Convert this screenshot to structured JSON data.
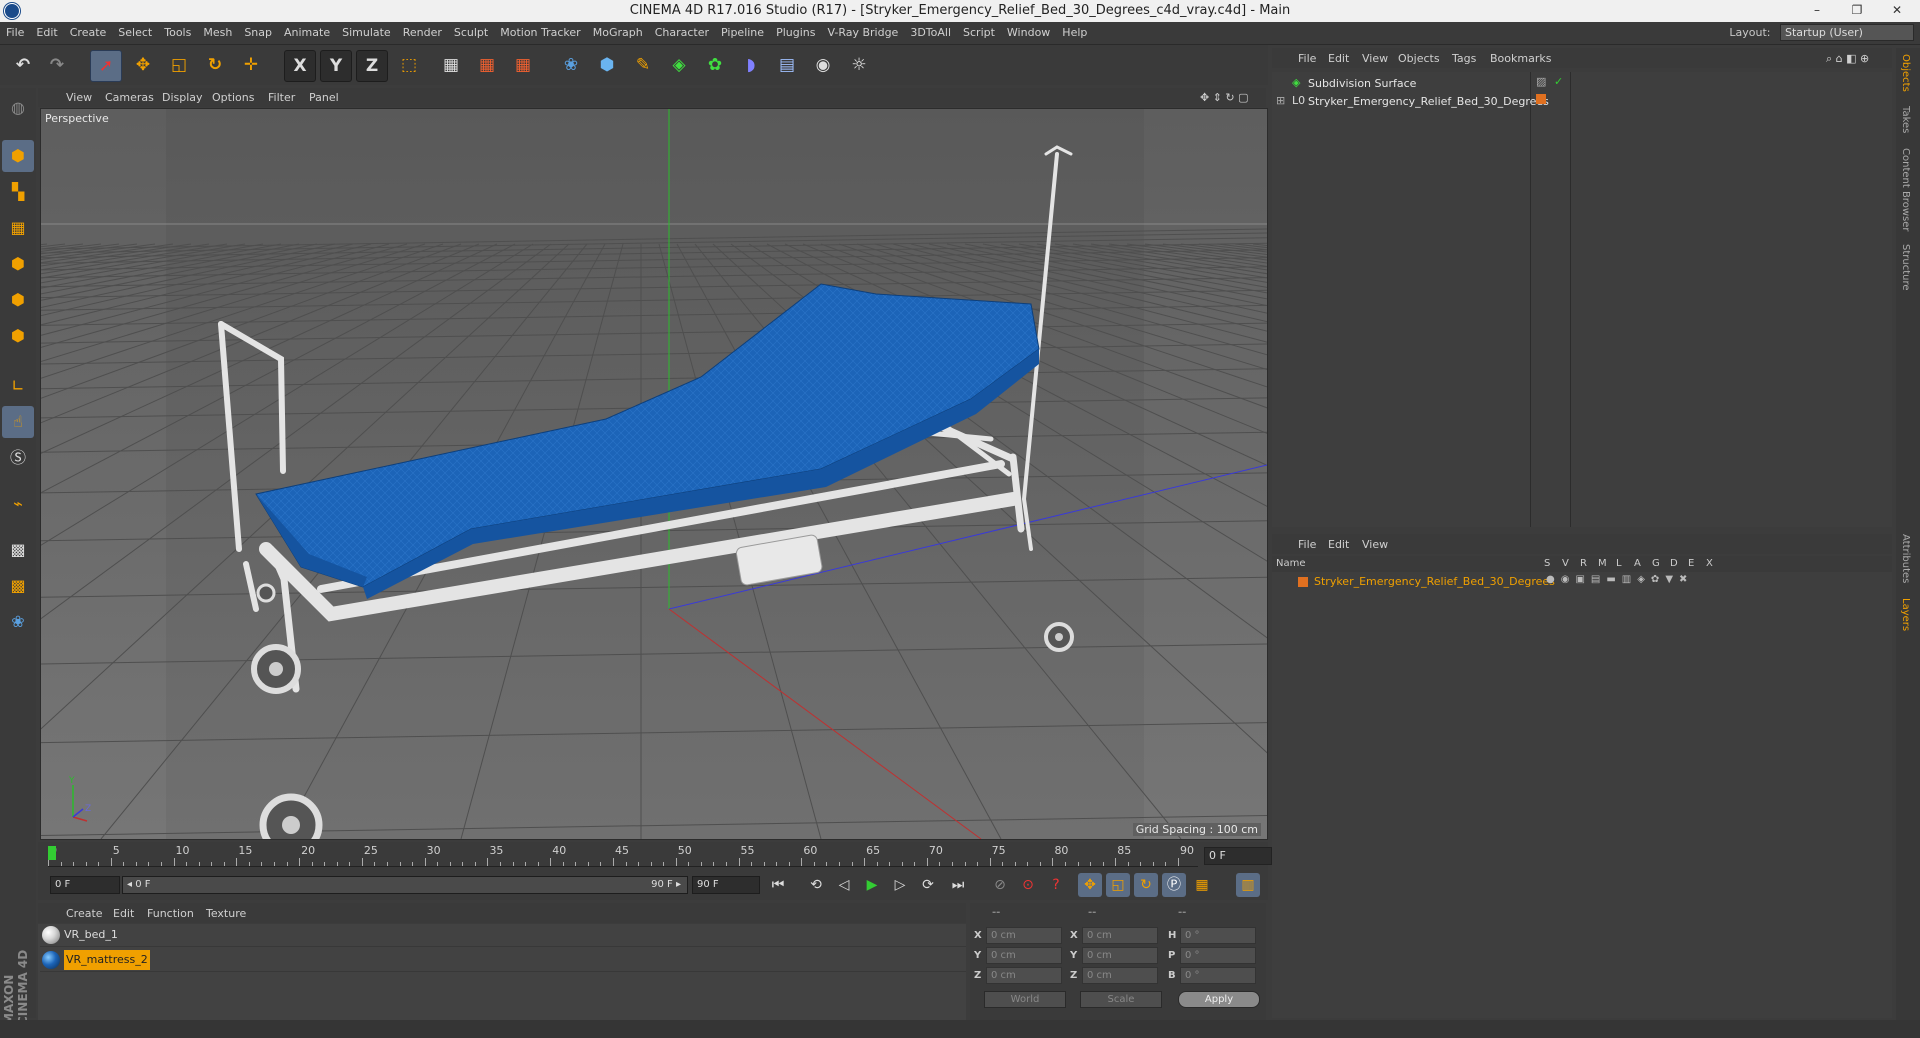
{
  "window": {
    "title": "CINEMA 4D R17.016 Studio (R17) - [Stryker_Emergency_Relief_Bed_30_Degrees_c4d_vray.c4d] - Main",
    "minimize": "–",
    "restore": "❐",
    "close": "✕"
  },
  "menubar": {
    "items": [
      "File",
      "Edit",
      "Create",
      "Select",
      "Tools",
      "Mesh",
      "Snap",
      "Animate",
      "Simulate",
      "Render",
      "Sculpt",
      "Motion Tracker",
      "MoGraph",
      "Character",
      "Pipeline",
      "Plugins",
      "V-Ray Bridge",
      "3DToAll",
      "Script",
      "Window",
      "Help"
    ],
    "layout_label": "Layout:",
    "layout_value": "Startup (User)"
  },
  "toolbar": {
    "icons": [
      "undo-icon",
      "redo-icon",
      "select-icon",
      "move-icon",
      "scale-icon",
      "rotate-icon",
      "transform-icon",
      "x-axis-icon",
      "y-axis-icon",
      "z-axis-icon",
      "coord-system-icon",
      "render-view-icon",
      "render-picture-queue-icon",
      "render-settings-icon",
      "python-icon",
      "cube-icon",
      "pen-icon",
      "subdivision-icon",
      "cloner-icon",
      "deformer-icon",
      "floor-icon",
      "camera-icon",
      "light-icon"
    ],
    "x_label": "X",
    "y_label": "Y",
    "z_label": "Z"
  },
  "left_tools": [
    "model-mode-icon",
    "texture-mode-icon",
    "workplane-icon",
    "points-icon",
    "edges-icon",
    "polygons-icon",
    "axis-icon",
    "tweak-icon",
    "solo-icon",
    "magnet-icon",
    "snap-icon",
    "lock-workplane-icon",
    "python-script-icon"
  ],
  "brand": "MAXON CINEMA 4D",
  "viewport": {
    "menu": [
      "View",
      "Cameras",
      "Display",
      "Options",
      "Filter",
      "Panel"
    ],
    "label": "Perspective",
    "grid_spacing": "Grid Spacing : 100 cm",
    "axis_y": "Y",
    "axis_z": "Z",
    "colors": {
      "background": "#6c6c6c",
      "mattress": "#1c64b8",
      "frame": "#e4e4e4",
      "green_axis": "#2bbd2b",
      "red_axis": "#c03030",
      "blue_axis": "#3a3ad8"
    }
  },
  "timeline": {
    "ticks": [
      "0",
      "5",
      "10",
      "15",
      "20",
      "25",
      "30",
      "35",
      "40",
      "45",
      "50",
      "55",
      "60",
      "65",
      "70",
      "75",
      "80",
      "85",
      "90"
    ],
    "current_frame": "0 F"
  },
  "transport": {
    "start": "0 F",
    "range_start": "◂ 0 F",
    "range_end": "90 F ▸",
    "end": "90 F"
  },
  "material_manager": {
    "menu": [
      "Create",
      "Edit",
      "Function",
      "Texture"
    ],
    "materials": [
      {
        "name": "VR_bed_1",
        "color": "#d8d8d8",
        "selected": false
      },
      {
        "name": "VR_mattress_2",
        "color": "#1c64b8",
        "selected": true
      }
    ]
  },
  "coordinates": {
    "headers": [
      "--",
      "--",
      "--"
    ],
    "rows": [
      {
        "a": "X",
        "av": "0 cm",
        "b": "X",
        "bv": "0 cm",
        "c": "H",
        "cv": "0 °"
      },
      {
        "a": "Y",
        "av": "0 cm",
        "b": "Y",
        "bv": "0 cm",
        "c": "P",
        "cv": "0 °"
      },
      {
        "a": "Z",
        "av": "0 cm",
        "b": "Z",
        "bv": "0 cm",
        "c": "B",
        "cv": "0 °"
      }
    ],
    "world": "World",
    "scale": "Scale",
    "apply": "Apply"
  },
  "object_manager": {
    "menu": [
      "File",
      "Edit",
      "View",
      "Objects",
      "Tags",
      "Bookmarks"
    ],
    "objects": [
      {
        "name": "Subdivision Surface",
        "icon": "subdivision-icon"
      },
      {
        "name": "Stryker_Emergency_Relief_Bed_30_Degrees",
        "icon": "null-object-icon"
      }
    ]
  },
  "layer_manager": {
    "menu": [
      "File",
      "Edit",
      "View"
    ],
    "columns": [
      "Name",
      "S",
      "V",
      "R",
      "M",
      "L",
      "A",
      "G",
      "D",
      "E",
      "X"
    ],
    "layers": [
      {
        "name": "Stryker_Emergency_Relief_Bed_30_Degrees",
        "color": "#e07020"
      }
    ]
  },
  "right_tabs": [
    "Objects",
    "Takes",
    "Content Browser",
    "Structure",
    "Attributes",
    "Layers"
  ]
}
